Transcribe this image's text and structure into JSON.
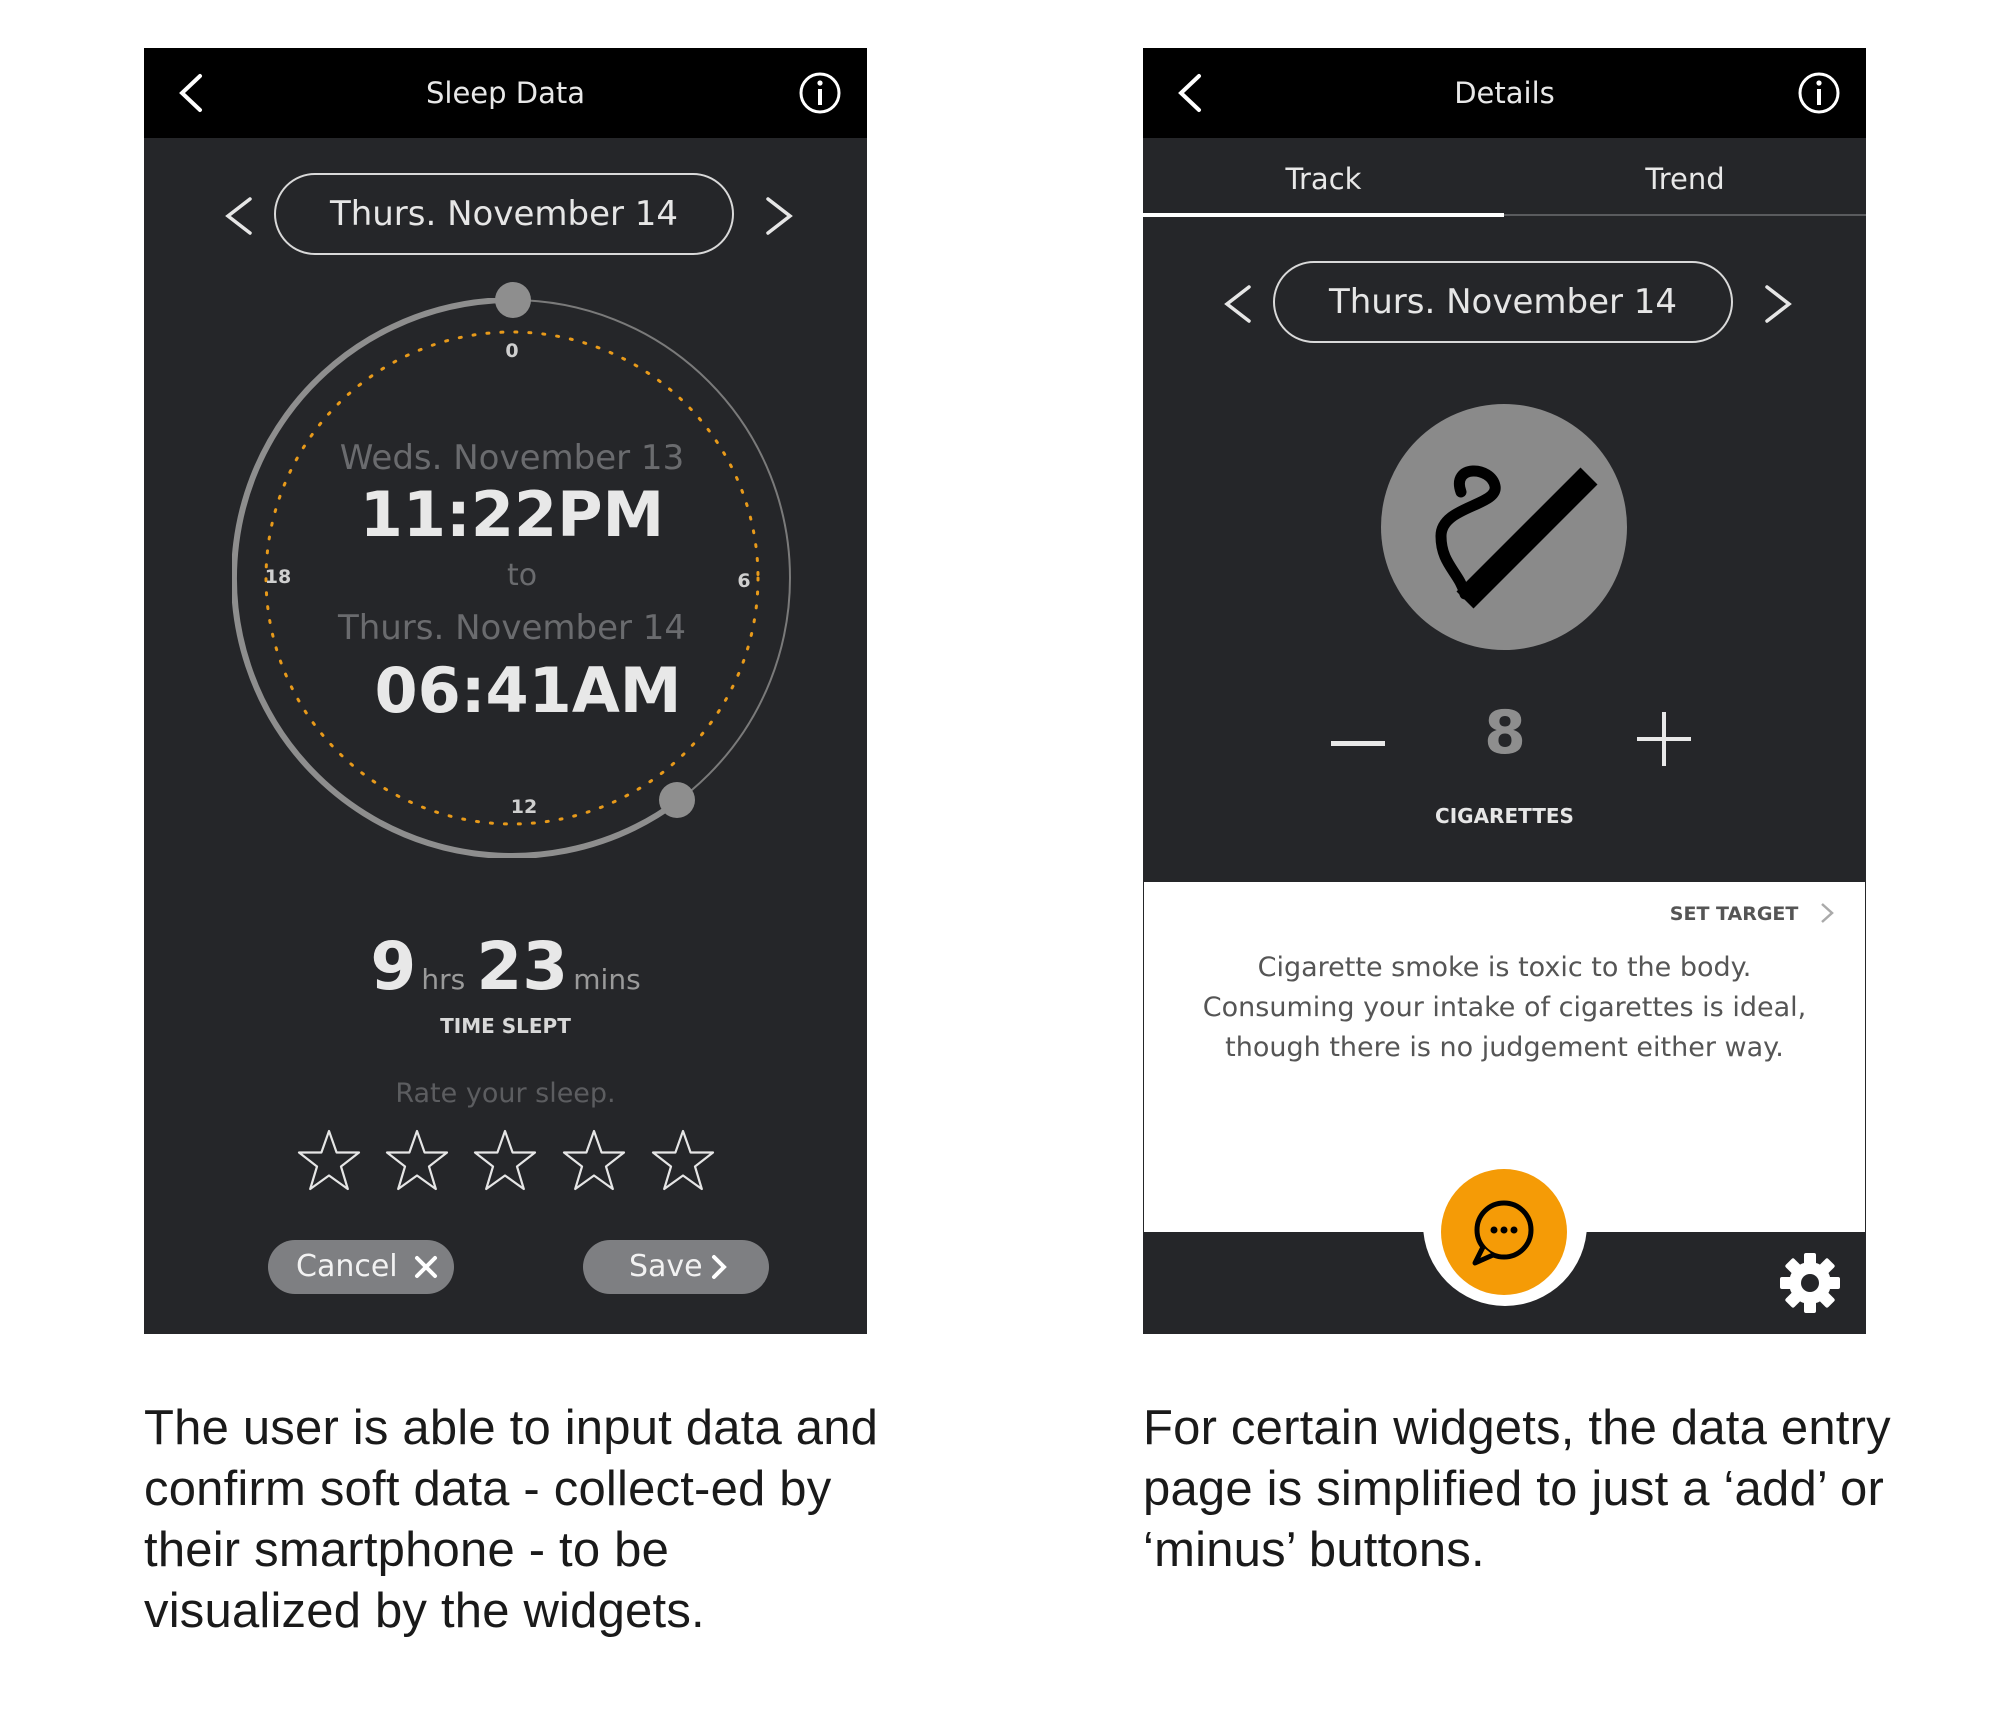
{
  "left_screen": {
    "title": "Sleep Data",
    "date_label": "Thurs. November 14",
    "clock": {
      "tick_top": "0",
      "tick_right": "6",
      "tick_bottom": "12",
      "tick_left": "18",
      "start_date": "Weds. November 13",
      "start_time": "11:22PM",
      "separator": "to",
      "end_date": "Thurs. November 14",
      "end_time": "06:41AM"
    },
    "duration": {
      "hours": "9",
      "hours_unit": "hrs",
      "minutes": "23",
      "minutes_unit": "mins",
      "caption": "TIME SLEPT"
    },
    "rating": {
      "prompt": "Rate your sleep.",
      "value": 0,
      "max": 5
    },
    "cancel_label": "Cancel",
    "save_label": "Save"
  },
  "right_screen": {
    "title": "Details",
    "tabs": [
      {
        "label": "Track",
        "active": true
      },
      {
        "label": "Trend",
        "active": false
      }
    ],
    "date_label": "Thurs. November 14",
    "icon": "smoking-icon",
    "count": "8",
    "count_label": "CIGARETTES",
    "set_target_label": "SET TARGET",
    "description": "Cigarette smoke is toxic to the body. Consuming your intake of cigarettes is ideal, though there is no judgement either way.",
    "chat_icon": "chat-bubble-icon",
    "settings_icon": "gear-icon"
  },
  "captions": {
    "left": "The user is able to input data and confirm soft data - collect-ed by their smartphone - to be visualized by the widgets.",
    "right": "For certain widgets, the data entry page is simplified to just a ‘add’ or ‘minus’ buttons."
  },
  "colors": {
    "screen_bg": "#252629",
    "topbar_bg": "#000000",
    "accent_orange": "#f59b06",
    "pill_gray": "#7e7f82",
    "icon_gray": "#8a8a8a"
  }
}
